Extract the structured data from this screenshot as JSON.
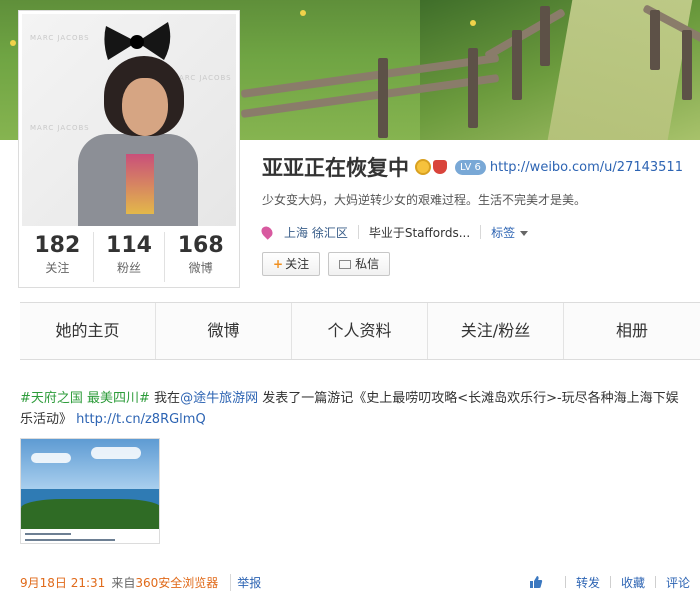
{
  "profile": {
    "name": "亚亚正在恢复中",
    "level_badge": "LV 6",
    "url": "http://weibo.com/u/27143511",
    "bio": "少女变大妈，大妈逆转少女的艰难过程。生活不完美才是美。",
    "location": "上海 徐汇区",
    "education": "毕业于Staffords...",
    "tags_label": "标签"
  },
  "stats": [
    {
      "num": "182",
      "label": "关注"
    },
    {
      "num": "114",
      "label": "粉丝"
    },
    {
      "num": "168",
      "label": "微博"
    }
  ],
  "buttons": {
    "follow": "关注",
    "message": "私信"
  },
  "tabs": [
    "她的主页",
    "微博",
    "个人资料",
    "关注/粉丝",
    "相册"
  ],
  "feed": {
    "topic": "#天府之国 最美四川#",
    "text_a": " 我在",
    "mention": "@途牛旅游网",
    "text_b": " 发表了一篇游记《史上最唠叨攻略<长滩岛欢乐行>-玩尽各种海上海下娱乐活动》",
    "link": "http://t.cn/z8RGlmQ",
    "time": "9月18日 21:31",
    "from_label": "来自",
    "source": "360安全浏览器",
    "report": "举报",
    "actions": {
      "repost": "转发",
      "favorite": "收藏",
      "comment": "评论"
    }
  },
  "colors": {
    "link_blue": "#2d64b3",
    "topic_green": "#2e9c3b",
    "time_orange": "#e06a1a"
  }
}
